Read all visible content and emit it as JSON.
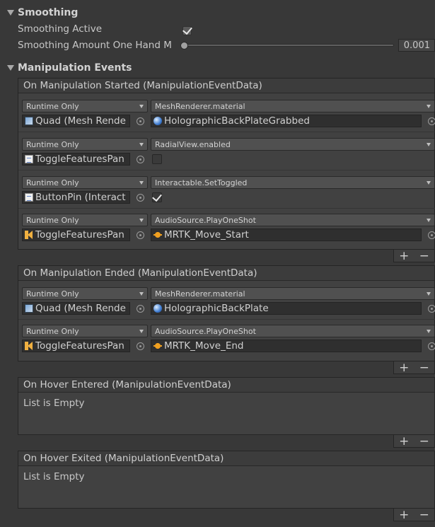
{
  "smoothing": {
    "title": "Smoothing",
    "active_label": "Smoothing Active",
    "active_checked": true,
    "amount_label": "Smoothing Amount One Hand M",
    "amount_value": "0.001",
    "amount_fraction": 0.001
  },
  "events": {
    "title": "Manipulation Events",
    "started": {
      "header": "On Manipulation Started (ManipulationEventData)",
      "items": [
        {
          "mode": "Runtime Only",
          "target": "Quad (Mesh Rende",
          "target_icon": "mesh-renderer-icon",
          "function": "MeshRenderer.material",
          "argument": "HolographicBackPlateGrabbed",
          "argument_icon": "material-icon"
        },
        {
          "mode": "Runtime Only",
          "target": "ToggleFeaturesPan",
          "target_icon": "script-icon",
          "function": "RadialView.enabled",
          "argument_checked": false
        },
        {
          "mode": "Runtime Only",
          "target": "ButtonPin (Interact",
          "target_icon": "script-icon",
          "function": "Interactable.SetToggled",
          "argument_checked": true
        },
        {
          "mode": "Runtime Only",
          "target": "ToggleFeaturesPan",
          "target_icon": "audio-source-icon",
          "function": "AudioSource.PlayOneShot",
          "argument": "MRTK_Move_Start",
          "argument_icon": "audio-clip-icon"
        }
      ]
    },
    "ended": {
      "header": "On Manipulation Ended (ManipulationEventData)",
      "items": [
        {
          "mode": "Runtime Only",
          "target": "Quad (Mesh Rende",
          "target_icon": "mesh-renderer-icon",
          "function": "MeshRenderer.material",
          "argument": "HolographicBackPlate",
          "argument_icon": "material-icon"
        },
        {
          "mode": "Runtime Only",
          "target": "ToggleFeaturesPan",
          "target_icon": "audio-source-icon",
          "function": "AudioSource.PlayOneShot",
          "argument": "MRTK_Move_End",
          "argument_icon": "audio-clip-icon"
        }
      ]
    },
    "hover_entered": {
      "header": "On Hover Entered (ManipulationEventData)",
      "empty_text": "List is Empty"
    },
    "hover_exited": {
      "header": "On Hover Exited (ManipulationEventData)",
      "empty_text": "List is Empty"
    },
    "add_label": "+",
    "remove_label": "−"
  }
}
